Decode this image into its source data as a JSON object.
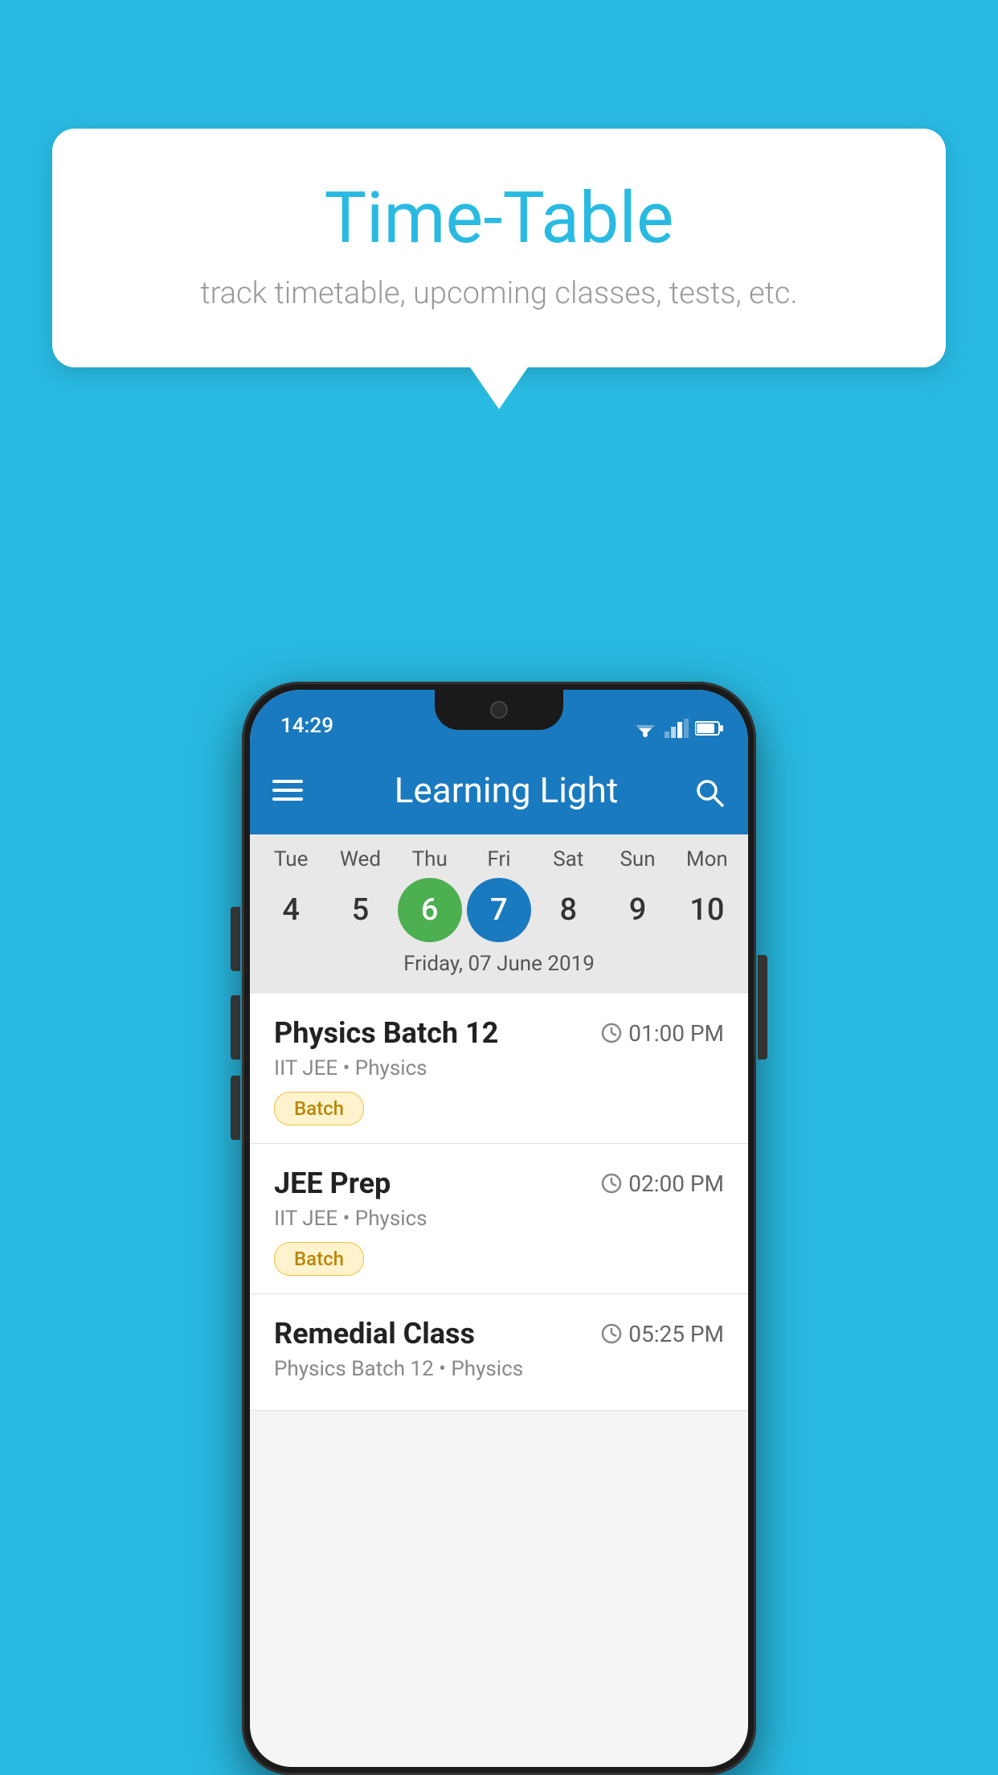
{
  "page": {
    "background_color": "#29BAE2"
  },
  "tooltip": {
    "title": "Time-Table",
    "subtitle": "track timetable, upcoming classes, tests, etc."
  },
  "status_bar": {
    "time": "14:29"
  },
  "app_bar": {
    "title": "Learning Light",
    "menu_icon_label": "menu",
    "search_icon_label": "search"
  },
  "calendar": {
    "selected_date_label": "Friday, 07 June 2019",
    "days": [
      {
        "name": "Tue",
        "number": "4",
        "state": "normal"
      },
      {
        "name": "Wed",
        "number": "5",
        "state": "normal"
      },
      {
        "name": "Thu",
        "number": "6",
        "state": "today"
      },
      {
        "name": "Fri",
        "number": "7",
        "state": "selected"
      },
      {
        "name": "Sat",
        "number": "8",
        "state": "normal"
      },
      {
        "name": "Sun",
        "number": "9",
        "state": "normal"
      },
      {
        "name": "Mon",
        "number": "10",
        "state": "normal"
      }
    ]
  },
  "classes": [
    {
      "name": "Physics Batch 12",
      "time": "01:00 PM",
      "meta": "IIT JEE • Physics",
      "badge": "Batch"
    },
    {
      "name": "JEE Prep",
      "time": "02:00 PM",
      "meta": "IIT JEE • Physics",
      "badge": "Batch"
    },
    {
      "name": "Remedial Class",
      "time": "05:25 PM",
      "meta": "Physics Batch 12 • Physics",
      "badge": ""
    }
  ]
}
